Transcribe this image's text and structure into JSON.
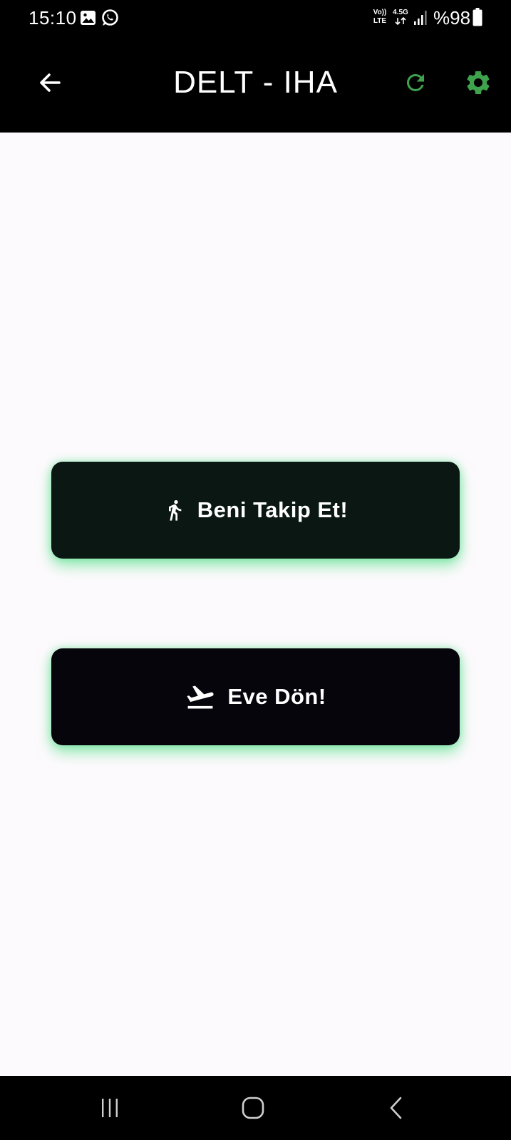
{
  "status_bar": {
    "time": "15:10",
    "network_volte": "Vo))",
    "network_lte": "LTE",
    "network_gen": "4.5G",
    "battery": "%98",
    "icons": [
      "gallery-icon",
      "whatsapp-icon",
      "signal-icon",
      "battery-icon"
    ]
  },
  "app_bar": {
    "title": "DELT - IHA",
    "back_icon": "arrow-left-icon",
    "refresh_icon": "refresh-icon",
    "settings_icon": "gear-icon",
    "accent_color": "#3fa34d"
  },
  "buttons": {
    "follow": {
      "label": "Beni Takip Et!",
      "icon": "walking-person-icon",
      "background": "#0a1712"
    },
    "return_home": {
      "label": "Eve Dön!",
      "icon": "flight-takeoff-icon",
      "background": "#07050c"
    },
    "glow_color": "#3cdc78"
  },
  "nav_bar": {
    "icons": [
      "recent-apps-icon",
      "home-icon",
      "back-icon"
    ]
  }
}
